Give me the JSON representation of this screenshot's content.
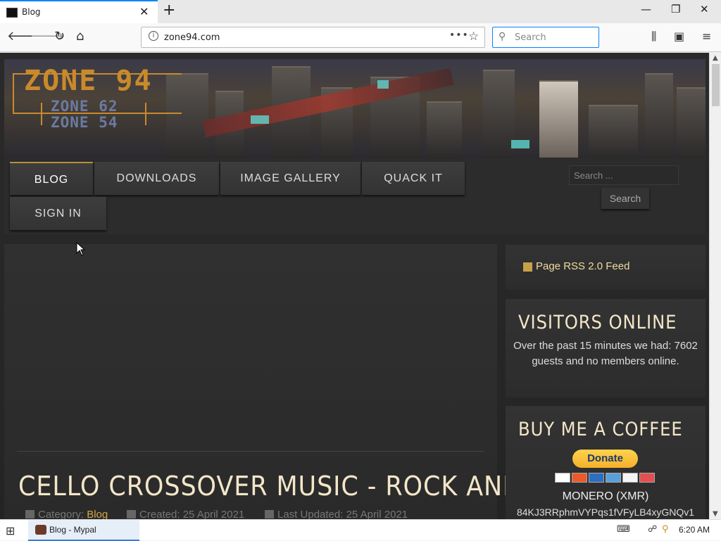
{
  "browser": {
    "tab_title": "Blog",
    "url": "zone94.com",
    "search_placeholder": "Search",
    "new_tab": "+",
    "tab_close": "✕",
    "window_controls": {
      "minimize": "—",
      "restore": "❐",
      "close": "✕"
    }
  },
  "site": {
    "logo_main": "ZONE 94",
    "logo_sub1": "ZONE 62",
    "logo_sub2": "ZONE 54",
    "menu": [
      "BLOG",
      "DOWNLOADS",
      "IMAGE GALLERY",
      "QUACK IT",
      "SIGN IN"
    ],
    "search_placeholder": "Search ...",
    "search_button": "Search"
  },
  "article": {
    "title": "CELLO CROSSOVER MUSIC - ROCK AND METAL",
    "category_label": "Category:",
    "category": "Blog",
    "created": "Created: 25 April 2021",
    "updated": "Last Updated: 25 April 2021"
  },
  "sidebar": {
    "rss": "Page RSS 2.0 Feed",
    "visitors_title": "VISITORS ONLINE",
    "visitors_text": "Over the past 15 minutes we had: 7602 guests and no members online.",
    "coffee_title": "BUY ME A COFFEE",
    "donate_label": "Donate",
    "monero_label": "MONERO (XMR)",
    "monero_address": "84KJ3RRphmVYPqs1fVFyLB4xyGNQv1"
  },
  "taskbar": {
    "item": "Blog - Mypal",
    "clock": "6:20 AM"
  },
  "colors": {
    "accent": "#0a84ff",
    "gold": "#d9a640",
    "title_cream": "#f3e6c8"
  }
}
